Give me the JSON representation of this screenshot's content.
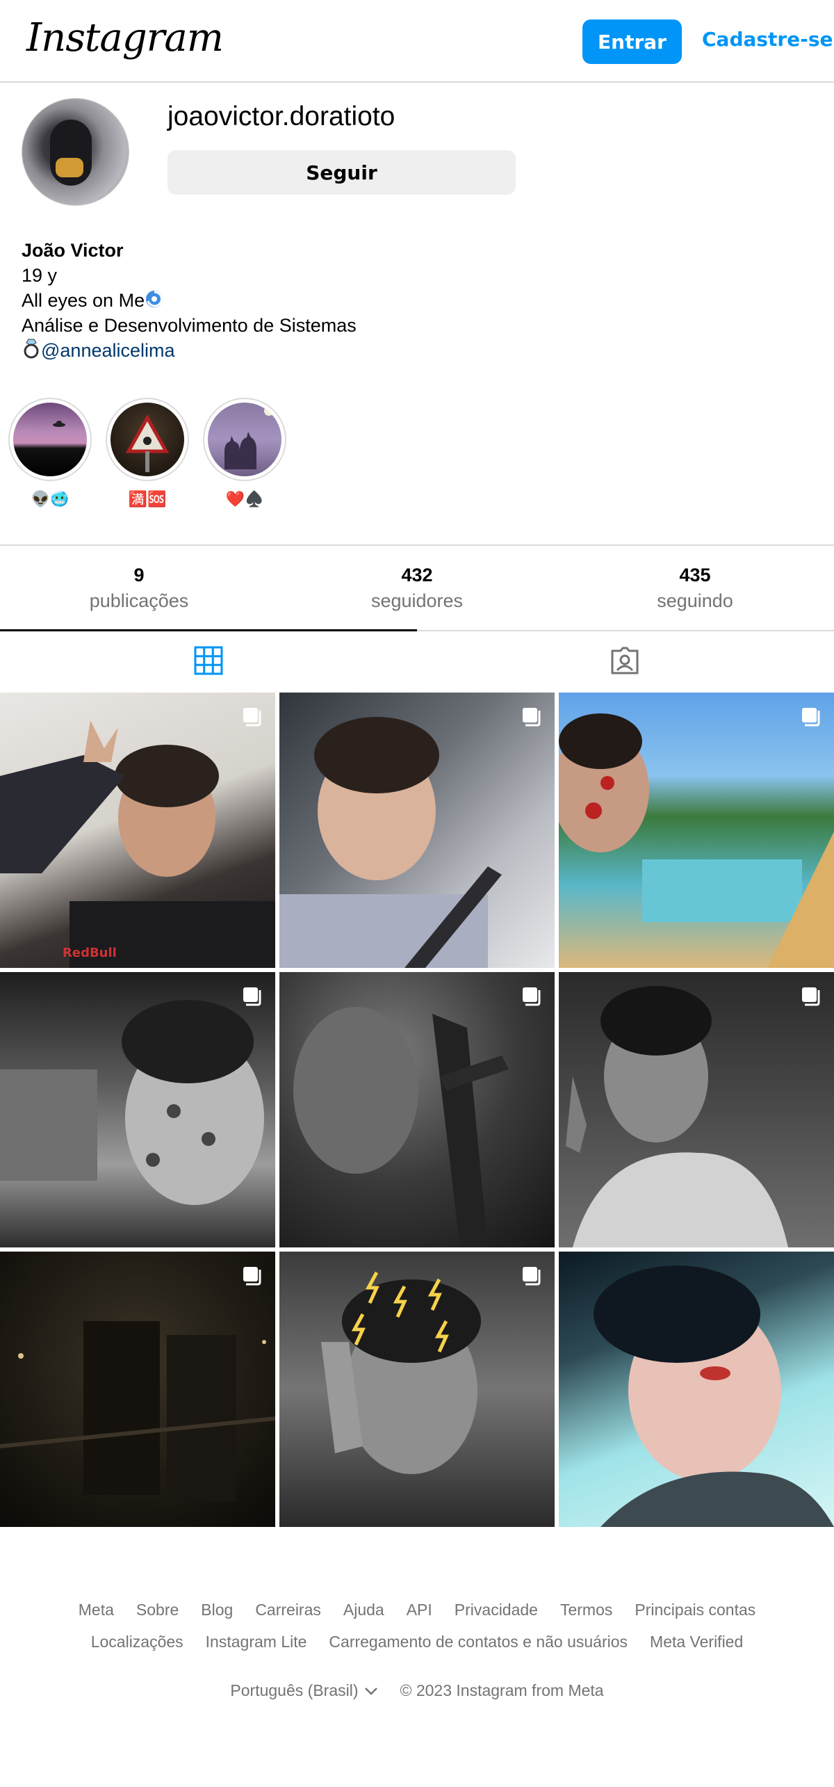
{
  "header": {
    "logo_text": "Instagram",
    "login_label": "Entrar",
    "signup_label": "Cadastre-se"
  },
  "profile": {
    "username": "joaovictor.doratioto",
    "follow_label": "Seguir",
    "bio": {
      "name": "João Victor",
      "line1": "19 y",
      "line2": "All eyes on Me",
      "line3": "Análise e Desenvolvimento de Sistemas",
      "mention": "@annealicelima"
    }
  },
  "highlights": [
    {
      "label": "👽🥶"
    },
    {
      "label": "🈵🆘"
    },
    {
      "label": "❤️♠️"
    }
  ],
  "stats": [
    {
      "value": "9",
      "label": "publicações"
    },
    {
      "value": "432",
      "label": "seguidores"
    },
    {
      "value": "435",
      "label": "seguindo"
    }
  ],
  "tabs": [
    {
      "name": "grid-icon",
      "active": true
    },
    {
      "name": "tagged-icon",
      "active": false
    }
  ],
  "posts": [
    {
      "multi": true
    },
    {
      "multi": true
    },
    {
      "multi": true
    },
    {
      "multi": true
    },
    {
      "multi": true
    },
    {
      "multi": true
    },
    {
      "multi": true
    },
    {
      "multi": true
    },
    {
      "multi": false
    }
  ],
  "footer": {
    "row1": [
      "Meta",
      "Sobre",
      "Blog",
      "Carreiras",
      "Ajuda",
      "API",
      "Privacidade",
      "Termos",
      "Principais contas"
    ],
    "row2": [
      "Localizações",
      "Instagram Lite",
      "Carregamento de contatos e não usuários",
      "Meta Verified"
    ],
    "language": "Português (Brasil)",
    "copyright": "© 2023 Instagram from Meta"
  },
  "colors": {
    "accent": "#0095f6",
    "border": "#dbdbdb",
    "muted": "#737373",
    "mention": "#00376b"
  }
}
